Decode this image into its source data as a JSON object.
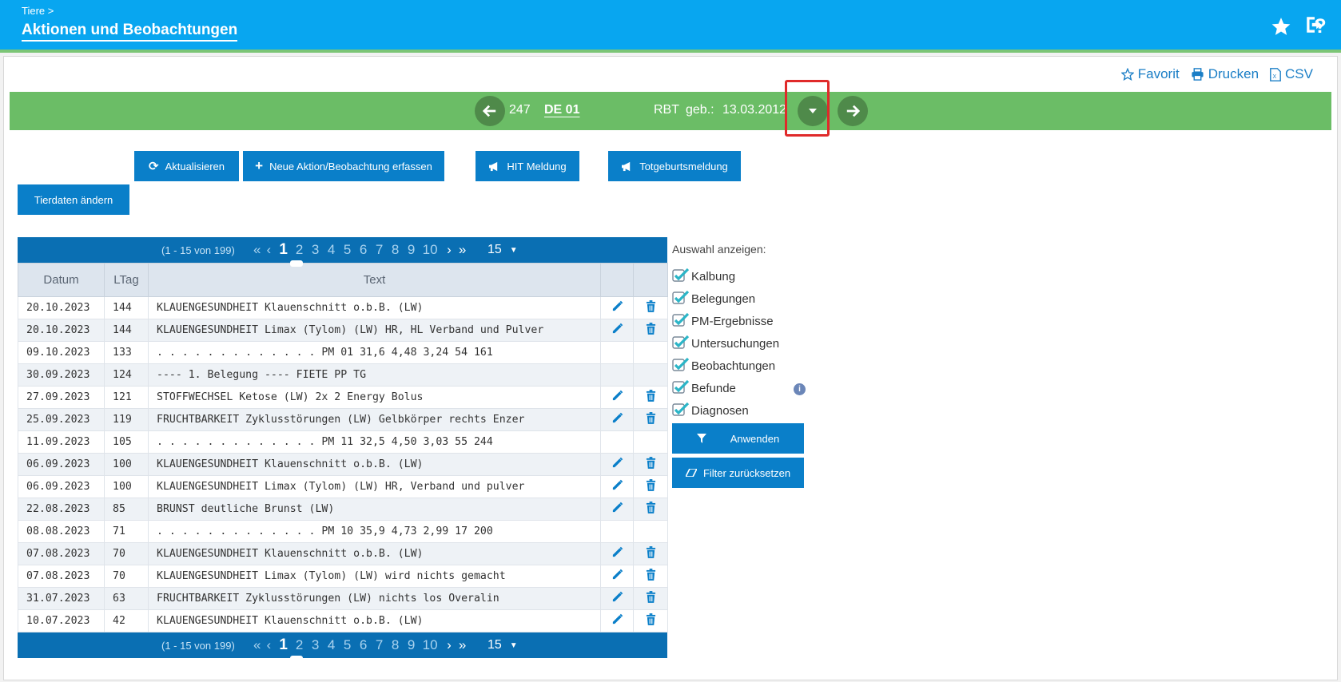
{
  "header": {
    "breadcrumb": "Tiere >",
    "title": "Aktionen und Beobachtungen",
    "icons": [
      "star-icon",
      "help-icon",
      "logout-icon"
    ]
  },
  "toplinks": {
    "favorit": "Favorit",
    "drucken": "Drucken",
    "csv": "CSV"
  },
  "animal": {
    "number": "247",
    "ohr": "DE 01",
    "breed": "RBT",
    "born_label": "geb.:",
    "born_date": "13.03.2012"
  },
  "buttons": {
    "refresh": "Aktualisieren",
    "new_action": "Neue Aktion/Beobachtung erfassen",
    "hit": "HIT Meldung",
    "stillbirth": "Totgeburtsmeldung",
    "edit_animal": "Tierdaten ändern",
    "apply": "Anwenden",
    "reset": "Filter zurücksetzen"
  },
  "pager": {
    "range": "(1 - 15 von 199)",
    "pages": [
      "1",
      "2",
      "3",
      "4",
      "5",
      "6",
      "7",
      "8",
      "9",
      "10"
    ],
    "current": "1",
    "per_page": "15"
  },
  "table": {
    "columns": [
      "Datum",
      "LTag",
      "Text"
    ],
    "rows": [
      {
        "date": "20.10.2023",
        "ltag": "144",
        "text": "KLAUENGESUNDHEIT Klauenschnitt o.b.B. (LW)",
        "actions": true
      },
      {
        "date": "20.10.2023",
        "ltag": "144",
        "text": "KLAUENGESUNDHEIT Limax (Tylom) (LW) HR, HL Verband und Pulver",
        "actions": true
      },
      {
        "date": "09.10.2023",
        "ltag": "133",
        "text": ". . . . . . . . . . . . . PM 01 31,6 4,48 3,24   54 161",
        "actions": false
      },
      {
        "date": "30.09.2023",
        "ltag": "124",
        "text": "---- 1. Belegung ---- FIETE PP TG",
        "actions": false
      },
      {
        "date": "27.09.2023",
        "ltag": "121",
        "text": "STOFFWECHSEL Ketose (LW) 2x 2 Energy Bolus",
        "actions": true
      },
      {
        "date": "25.09.2023",
        "ltag": "119",
        "text": "FRUCHTBARKEIT Zyklusstörungen (LW) Gelbkörper rechts Enzer",
        "actions": true
      },
      {
        "date": "11.09.2023",
        "ltag": "105",
        "text": ". . . . . . . . . . . . . PM 11 32,5 4,50 3,03   55 244",
        "actions": false
      },
      {
        "date": "06.09.2023",
        "ltag": "100",
        "text": "KLAUENGESUNDHEIT Klauenschnitt o.b.B. (LW)",
        "actions": true
      },
      {
        "date": "06.09.2023",
        "ltag": "100",
        "text": "KLAUENGESUNDHEIT Limax (Tylom) (LW) HR, Verband und pulver",
        "actions": true
      },
      {
        "date": "22.08.2023",
        "ltag": "85",
        "text": "BRUNST deutliche Brunst (LW)",
        "actions": true
      },
      {
        "date": "08.08.2023",
        "ltag": "71",
        "text": ". . . . . . . . . . . . . PM 10 35,9 4,73 2,99   17 200",
        "actions": false
      },
      {
        "date": "07.08.2023",
        "ltag": "70",
        "text": "KLAUENGESUNDHEIT Klauenschnitt o.b.B. (LW)",
        "actions": true
      },
      {
        "date": "07.08.2023",
        "ltag": "70",
        "text": "KLAUENGESUNDHEIT Limax (Tylom) (LW) wird nichts gemacht",
        "actions": true
      },
      {
        "date": "31.07.2023",
        "ltag": "63",
        "text": "FRUCHTBARKEIT Zyklusstörungen (LW) nichts los Overalin",
        "actions": true
      },
      {
        "date": "10.07.2023",
        "ltag": "42",
        "text": "KLAUENGESUNDHEIT Klauenschnitt o.b.B. (LW)",
        "actions": true
      }
    ]
  },
  "filter": {
    "title": "Auswahl anzeigen:",
    "options": [
      {
        "label": "Kalbung",
        "checked": true
      },
      {
        "label": "Belegungen",
        "checked": true
      },
      {
        "label": "PM-Ergebnisse",
        "checked": true
      },
      {
        "label": "Untersuchungen",
        "checked": true
      },
      {
        "label": "Beobachtungen",
        "checked": true
      },
      {
        "label": "Befunde",
        "checked": true
      },
      {
        "label": "Diagnosen",
        "checked": true
      }
    ],
    "info_icon": "i"
  },
  "colors": {
    "header": "#08a6f0",
    "animal_bar": "#6bbd66",
    "button": "#0a7fc9",
    "pager": "#0a6fb3"
  }
}
